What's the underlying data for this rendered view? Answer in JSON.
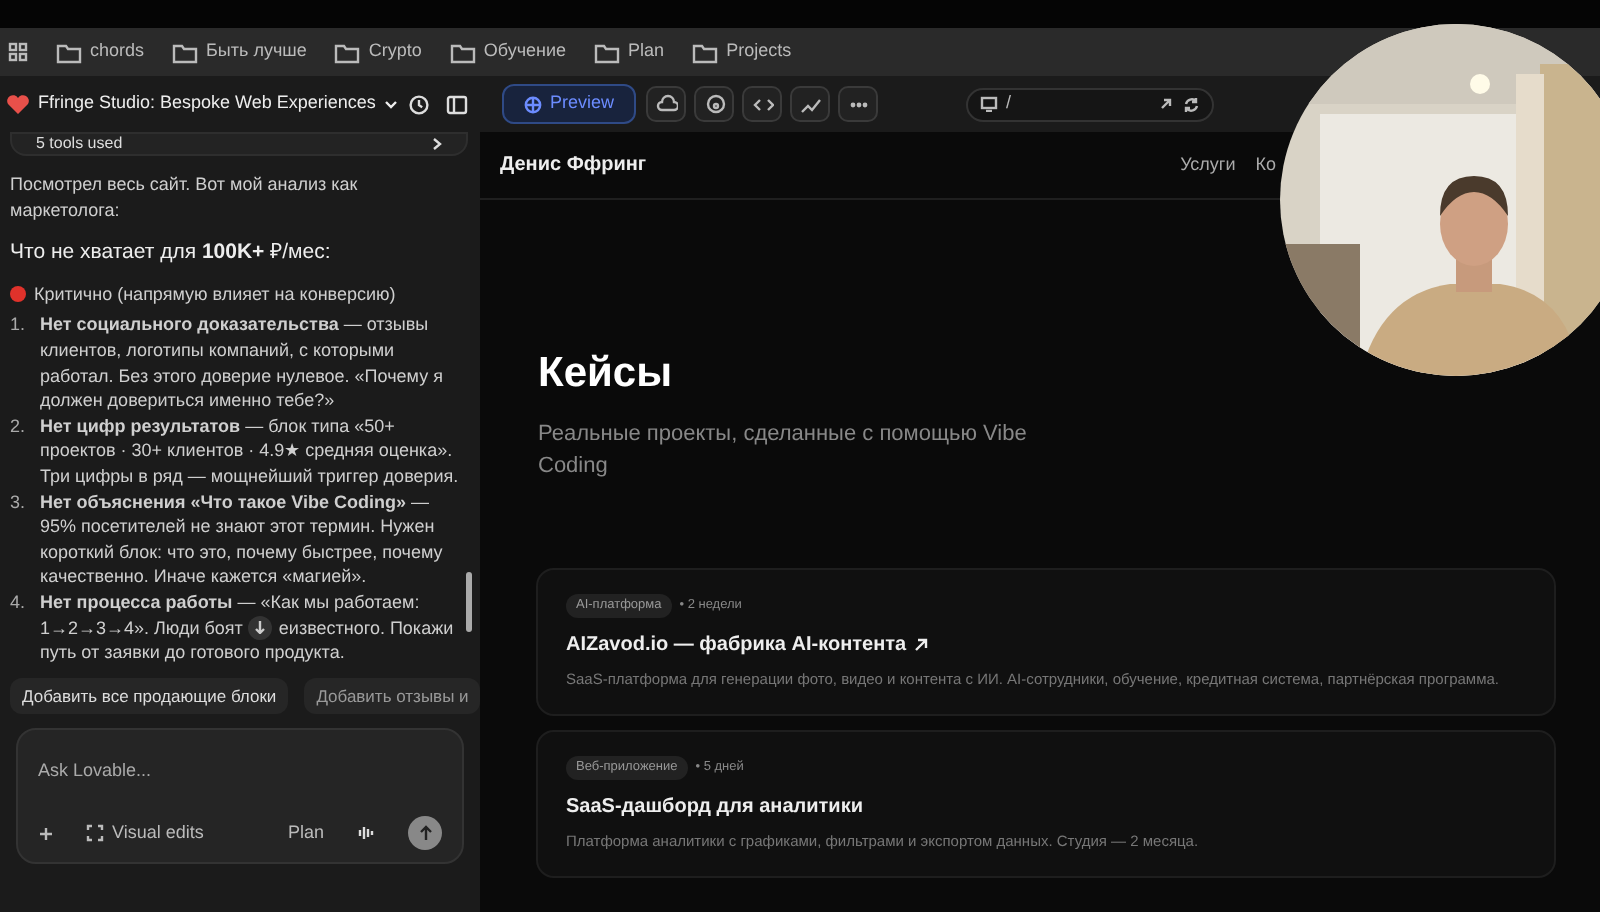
{
  "bookmarks": [
    {
      "label": "chords"
    },
    {
      "label": "Быть лучше"
    },
    {
      "label": "Crypto"
    },
    {
      "label": "Обучение"
    },
    {
      "label": "Plan"
    },
    {
      "label": "Projects"
    }
  ],
  "project": {
    "title": "Ffringe Studio: Bespoke Web Experiences"
  },
  "toolbar": {
    "preview": {
      "label": "Preview",
      "selected": true
    },
    "url": "/"
  },
  "chat": {
    "tools_summary": "5 tools used",
    "intro": "Посмотрел весь сайт. Вот мой анализ как маркетолога:",
    "heading": "Что не хватает для **100K+** ₽/мес:",
    "priority": {
      "label": "Критично (напрямую влияет на конверсию)",
      "color": "#e0322b"
    },
    "items": [
      {
        "number": "1.",
        "text": "**Нет социального доказательства** — отзывы клиентов, логотипы компаний, с которыми работал. Без этого доверие нулевое. «Почему я должен довериться именно тебе?»"
      },
      {
        "number": "2.",
        "text": "**Нет цифр результатов** — блок типа «50+ проектов · 30+ клиентов · 4.9★ средняя оценка». Три цифры в ряд — мощнейший триггер доверия."
      },
      {
        "number": "3.",
        "text": "**Нет объяснения «Что такое Vibe Coding»** — 95% посетителей не знают этот термин. Нужен короткий блок: что это, почему быстрее, почему качественно. Иначе кажется «магией»."
      },
      {
        "number": "4.",
        "lines": [
          [
            "**Нет процесса работы** — «Как мы работаем:"
          ],
          [
            "1→2→3→4». Люди боят",
            "еизвестного. Покажи"
          ],
          [
            "путь от заявки до готового продукта."
          ]
        ]
      }
    ],
    "suggestions": [
      "Добавить все продающие блоки",
      "Добавить отзывы и"
    ],
    "input": {
      "placeholder": "Ask Lovable...",
      "visual_edits": "Visual edits",
      "plan": "Plan"
    }
  },
  "site": {
    "brand": "Денис Ффринг",
    "nav": [
      "Услуги",
      "Ко"
    ],
    "title": "Кейсы",
    "subtitle": "Реальные проекты, сделанные с помощью Vibe Coding",
    "cases": [
      {
        "tag": "AI-платформа",
        "duration": "• 2 недели",
        "title": "AIZavod.io — фабрика AI-контента",
        "external": true,
        "description": "SaaS-платформа для генерации фото, видео и контента с ИИ. AI-сотрудники, обучение, кредитная система, партнёрская программа."
      },
      {
        "tag": "Веб-приложение",
        "duration": "• 5 дней",
        "title": "SaaS-дашборд для аналитики",
        "external": false,
        "description": "Платформа аналитики с графиками, фильтрами и экспортом данных. Студия — 2 месяца."
      }
    ]
  }
}
